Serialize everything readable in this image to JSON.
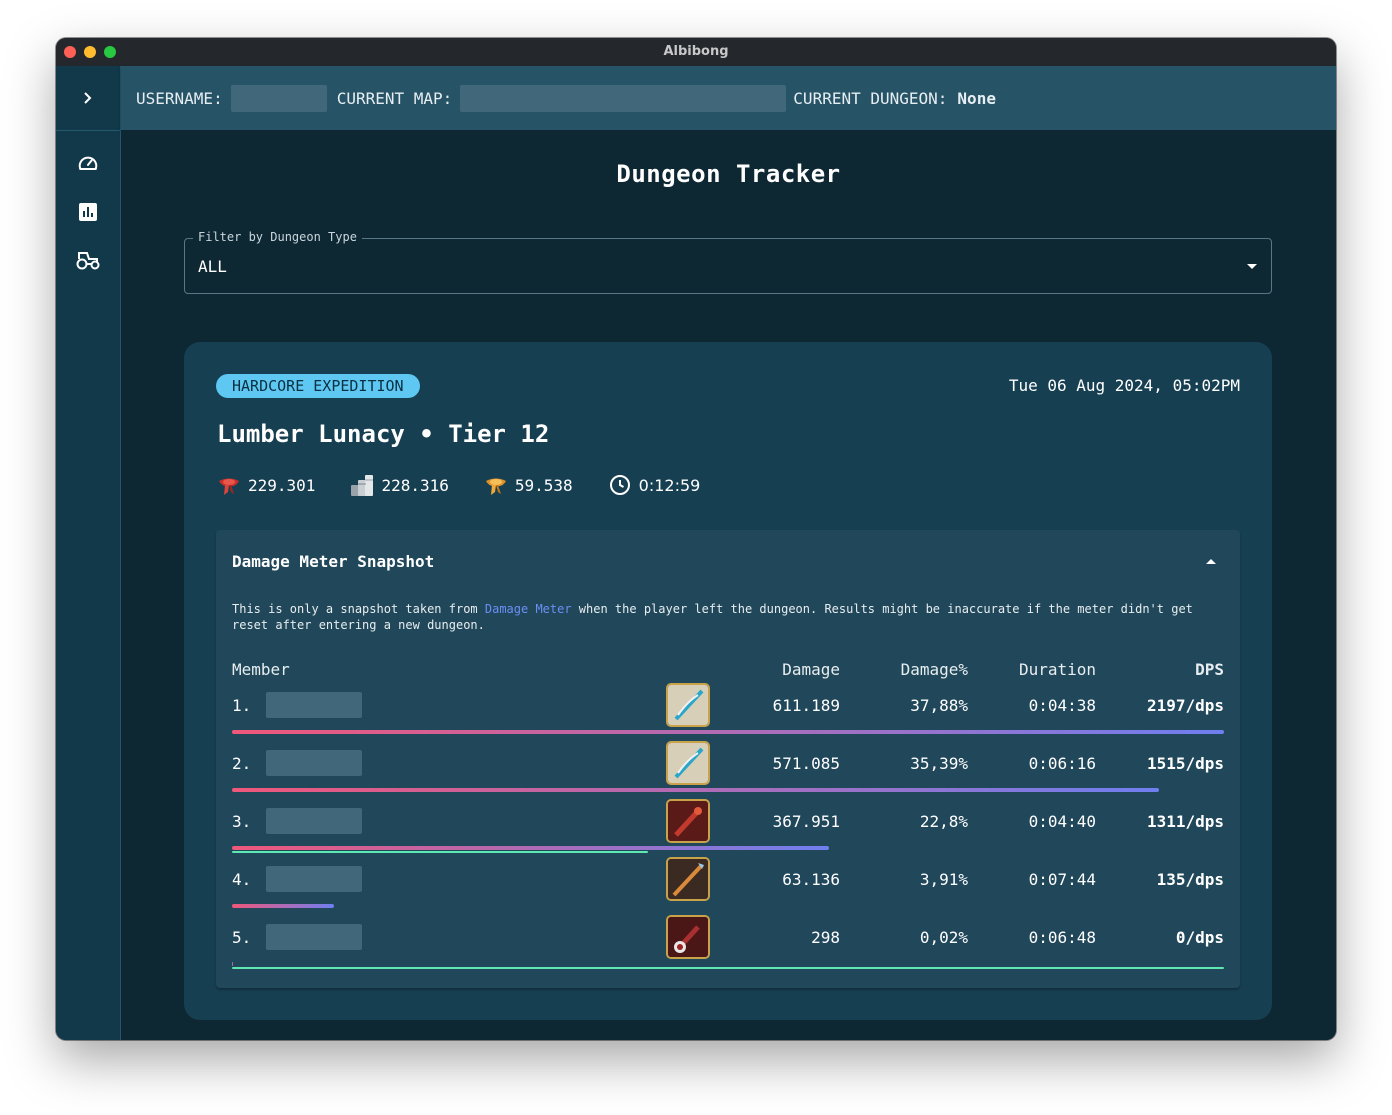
{
  "window": {
    "title": "Albibong"
  },
  "topbar": {
    "username_label": "USERNAME:",
    "map_label": "CURRENT MAP:",
    "dungeon_label": "CURRENT DUNGEON:",
    "dungeon_value": "None"
  },
  "page": {
    "title": "Dungeon Tracker"
  },
  "filter": {
    "label": "Filter by Dungeon Type",
    "value": "ALL"
  },
  "card": {
    "badge": "HARDCORE EXPEDITION",
    "date": "Tue 06 Aug 2024, 05:02PM",
    "title": "Lumber Lunacy • Tier 12",
    "stats": {
      "fame": "229.301",
      "silver": "228.316",
      "respec": "59.538",
      "duration": "0:12:59"
    },
    "meter": {
      "heading": "Damage Meter Snapshot",
      "note_before": "This is only a snapshot taken from ",
      "note_link": "Damage Meter",
      "note_after": " when the player left the dungeon. Results might be inaccurate if the meter didn't get reset after entering a new dungeon.",
      "columns": {
        "member": "Member",
        "damage": "Damage",
        "damage_pct": "Damage%",
        "duration": "Duration",
        "dps": "DPS"
      },
      "rows": [
        {
          "rank": "1.",
          "damage": "611.189",
          "damage_pct": "37,88%",
          "duration": "0:04:38",
          "dps": "2197/dps",
          "damage_bar": 1.0,
          "heal_bar": 0.0,
          "weapon_icon": "bow-weapon-icon"
        },
        {
          "rank": "2.",
          "damage": "571.085",
          "damage_pct": "35,39%",
          "duration": "0:06:16",
          "dps": "1515/dps",
          "damage_bar": 0.934,
          "heal_bar": 0.0,
          "weapon_icon": "bow-weapon-icon"
        },
        {
          "rank": "3.",
          "damage": "367.951",
          "damage_pct": "22,8%",
          "duration": "0:04:40",
          "dps": "1311/dps",
          "damage_bar": 0.602,
          "heal_bar": 0.419,
          "weapon_icon": "staff-weapon-icon"
        },
        {
          "rank": "4.",
          "damage": "63.136",
          "damage_pct": "3,91%",
          "duration": "0:07:44",
          "dps": "135/dps",
          "damage_bar": 0.103,
          "heal_bar": 0.0,
          "weapon_icon": "spear-weapon-icon"
        },
        {
          "rank": "5.",
          "damage": "298",
          "damage_pct": "0,02%",
          "duration": "0:06:48",
          "dps": "0/dps",
          "damage_bar": 0.001,
          "heal_bar": 1.0,
          "weapon_icon": "mace-weapon-icon"
        }
      ]
    }
  },
  "colors": {
    "accent_badge": "#5ec8f2",
    "damage_bar_start": "#f0577a",
    "damage_bar_end": "#6f7ff0",
    "heal_bar": "#5fe8b4",
    "link": "#6b8ff5"
  }
}
